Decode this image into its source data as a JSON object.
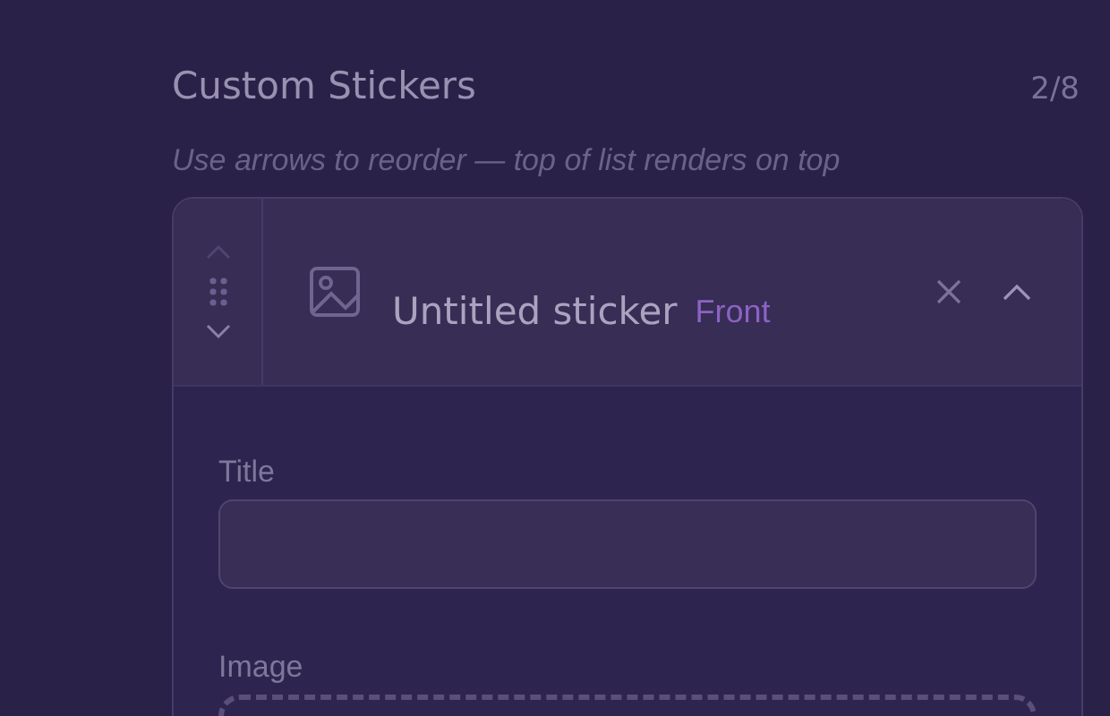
{
  "section": {
    "title": "Custom Stickers",
    "count": "2/8",
    "hint": "Use arrows to reorder — top of list renders on top"
  },
  "stickers": [
    {
      "name": "Untitled sticker",
      "tag": "Front",
      "expanded": true,
      "fields": [
        {
          "kind": "text",
          "label": "Title"
        },
        {
          "kind": "image",
          "label": "Image"
        }
      ]
    }
  ]
}
